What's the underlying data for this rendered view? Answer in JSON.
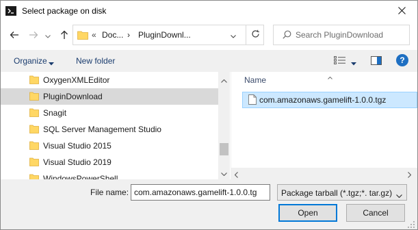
{
  "window": {
    "title": "Select package on disk"
  },
  "nav": {
    "address_overflow": "«",
    "address_segments": [
      "Doc...",
      "PluginDownl..."
    ],
    "search_placeholder": "Search PluginDownload"
  },
  "toolbar": {
    "organize_label": "Organize",
    "new_folder_label": "New folder",
    "help_label": "?"
  },
  "sidebar": {
    "items": [
      {
        "label": "OxygenXMLEditor",
        "selected": false
      },
      {
        "label": "PluginDownload",
        "selected": true
      },
      {
        "label": "Snagit",
        "selected": false
      },
      {
        "label": "SQL Server Management Studio",
        "selected": false
      },
      {
        "label": "Visual Studio 2015",
        "selected": false
      },
      {
        "label": "Visual Studio 2019",
        "selected": false
      },
      {
        "label": "WindowsPowerShell",
        "selected": false
      }
    ]
  },
  "file_list": {
    "column_name": "Name",
    "files": [
      {
        "name": "com.amazonaws.gamelift-1.0.0.tgz",
        "selected": true
      }
    ]
  },
  "footer": {
    "file_name_label": "File name:",
    "file_name_value": "com.amazonaws.gamelift-1.0.0.tg",
    "file_type_value": "Package tarball (*.tgz;*. tar.gz)",
    "open_label": "Open",
    "cancel_label": "Cancel"
  },
  "colors": {
    "accent": "#0078d7",
    "selection_file": "#cce8ff",
    "selection_sidebar": "#d9d9d9",
    "folder": "#ffd764"
  }
}
